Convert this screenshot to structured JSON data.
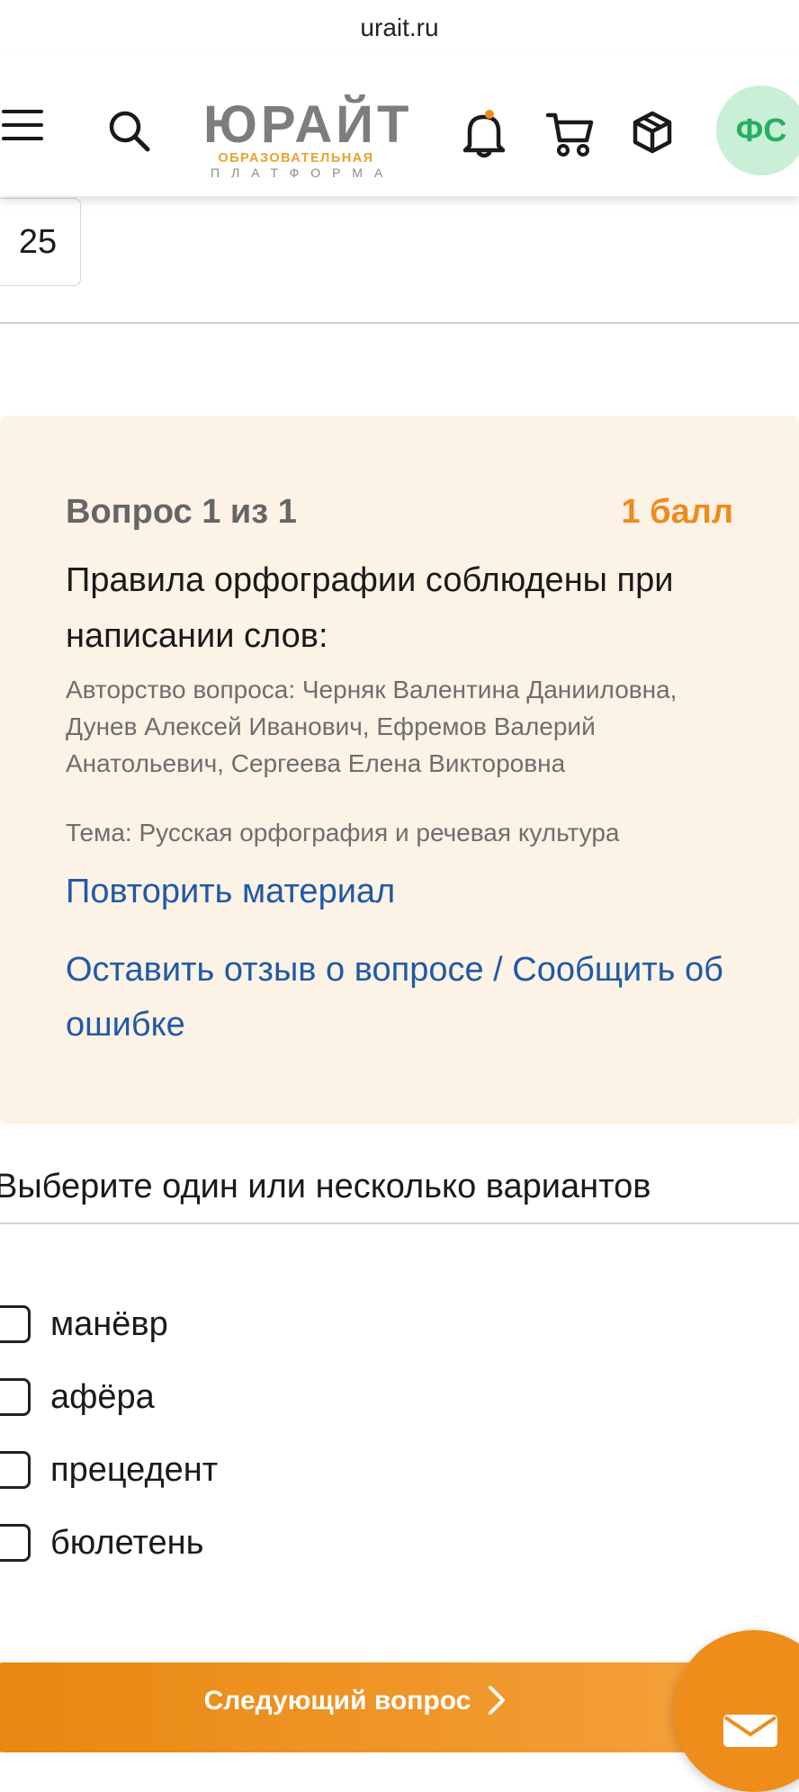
{
  "browser": {
    "url": "urait.ru"
  },
  "header": {
    "logo_main": "ЮРАЙТ",
    "logo_sub1": "ОБРАЗОВАТЕЛЬНАЯ",
    "logo_sub2": "ПЛАТФОРМА",
    "avatar_initials": "ФС",
    "icons": [
      "menu-icon",
      "search-icon",
      "bell-icon",
      "cart-icon",
      "box-icon"
    ]
  },
  "pager": {
    "current": "25"
  },
  "question": {
    "number_label": "Вопрос 1 из 1",
    "score": "1 балл",
    "text": "Правила орфографии соблюдены при написании слов:",
    "authors": "Авторство вопроса: Черняк Валентина Данииловна, Дунев Алексей Иванович, Ефремов Валерий Анатольевич, Сергеева Елена Викторовна",
    "topic": "Тема: Русская орфография и речевая культура",
    "repeat_link": "Повторить материал",
    "feedback_link": "Оставить отзыв о вопросе / Сообщить об ошибке"
  },
  "answers": {
    "instruction": "Выберите один или несколько вариантов",
    "options": [
      {
        "label": "манёвр",
        "checked": false
      },
      {
        "label": "афёра",
        "checked": false
      },
      {
        "label": "прецедент",
        "checked": false
      },
      {
        "label": "бюлетень",
        "checked": false
      }
    ]
  },
  "footer": {
    "next_button": "Следующий вопрос"
  },
  "colors": {
    "accent": "#ef8b1d",
    "card_bg": "#fdf2e6",
    "link": "#1f5aa6",
    "avatar_bg": "#c9efd6",
    "avatar_text": "#24b063"
  }
}
